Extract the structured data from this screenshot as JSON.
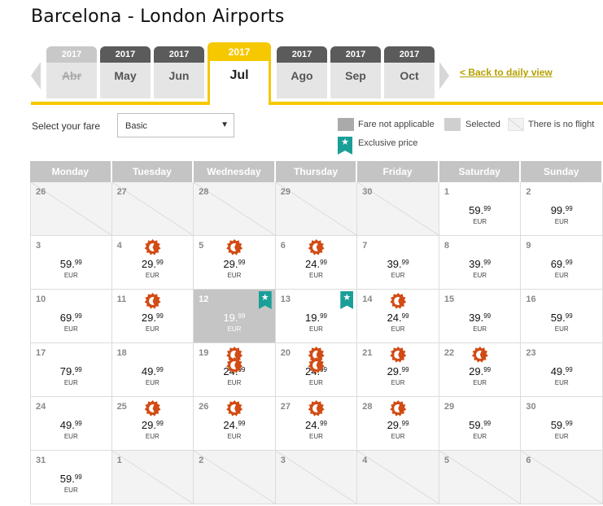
{
  "page": {
    "title": "Barcelona - London Airports"
  },
  "tabs": [
    {
      "year": "2017",
      "month": "Abr",
      "state": "disabled"
    },
    {
      "year": "2017",
      "month": "May",
      "state": "normal"
    },
    {
      "year": "2017",
      "month": "Jun",
      "state": "normal"
    },
    {
      "year": "2017",
      "month": "Jul",
      "state": "active"
    },
    {
      "year": "2017",
      "month": "Ago",
      "state": "normal"
    },
    {
      "year": "2017",
      "month": "Sep",
      "state": "normal"
    },
    {
      "year": "2017",
      "month": "Oct",
      "state": "normal"
    }
  ],
  "back_link": "< Back to daily view",
  "fare": {
    "label": "Select your fare",
    "selected": "Basic"
  },
  "legend": {
    "not_applicable": "Fare not applicable",
    "selected": "Selected",
    "no_flight": "There is no flight",
    "exclusive": "Exclusive price"
  },
  "weekdays": [
    "Monday",
    "Tuesday",
    "Wednesday",
    "Thursday",
    "Friday",
    "Saturday",
    "Sunday"
  ],
  "currency": "EUR",
  "cells": [
    {
      "day": "26",
      "noflight": true
    },
    {
      "day": "27",
      "noflight": true
    },
    {
      "day": "28",
      "noflight": true
    },
    {
      "day": "29",
      "noflight": true
    },
    {
      "day": "30",
      "noflight": true
    },
    {
      "day": "1",
      "int": "59.",
      "dec": "99",
      "badges": 0
    },
    {
      "day": "2",
      "int": "99.",
      "dec": "99",
      "badges": 0
    },
    {
      "day": "3",
      "int": "59.",
      "dec": "99",
      "badges": 0
    },
    {
      "day": "4",
      "int": "29.",
      "dec": "99",
      "badges": 1
    },
    {
      "day": "5",
      "int": "29.",
      "dec": "99",
      "badges": 1
    },
    {
      "day": "6",
      "int": "24.",
      "dec": "99",
      "badges": 1
    },
    {
      "day": "7",
      "int": "39.",
      "dec": "99",
      "badges": 0
    },
    {
      "day": "8",
      "int": "39.",
      "dec": "99",
      "badges": 0
    },
    {
      "day": "9",
      "int": "69.",
      "dec": "99",
      "badges": 0
    },
    {
      "day": "10",
      "int": "69.",
      "dec": "99",
      "badges": 0
    },
    {
      "day": "11",
      "int": "29.",
      "dec": "99",
      "badges": 1
    },
    {
      "day": "12",
      "int": "19.",
      "dec": "99",
      "badges": 0,
      "selected": true,
      "exclusive": true
    },
    {
      "day": "13",
      "int": "19.",
      "dec": "99",
      "badges": 0,
      "exclusive": true
    },
    {
      "day": "14",
      "int": "24.",
      "dec": "99",
      "badges": 1
    },
    {
      "day": "15",
      "int": "39.",
      "dec": "99",
      "badges": 0
    },
    {
      "day": "16",
      "int": "59.",
      "dec": "99",
      "badges": 0
    },
    {
      "day": "17",
      "int": "79.",
      "dec": "99",
      "badges": 0
    },
    {
      "day": "18",
      "int": "49.",
      "dec": "99",
      "badges": 0
    },
    {
      "day": "19",
      "int": "24.",
      "dec": "99",
      "badges": 2
    },
    {
      "day": "20",
      "int": "24.",
      "dec": "99",
      "badges": 2
    },
    {
      "day": "21",
      "int": "29.",
      "dec": "99",
      "badges": 1
    },
    {
      "day": "22",
      "int": "29.",
      "dec": "99",
      "badges": 1
    },
    {
      "day": "23",
      "int": "49.",
      "dec": "99",
      "badges": 0
    },
    {
      "day": "24",
      "int": "49.",
      "dec": "99",
      "badges": 0
    },
    {
      "day": "25",
      "int": "29.",
      "dec": "99",
      "badges": 1
    },
    {
      "day": "26",
      "int": "24.",
      "dec": "99",
      "badges": 1
    },
    {
      "day": "27",
      "int": "24.",
      "dec": "99",
      "badges": 1
    },
    {
      "day": "28",
      "int": "29.",
      "dec": "99",
      "badges": 1
    },
    {
      "day": "29",
      "int": "59.",
      "dec": "99",
      "badges": 0
    },
    {
      "day": "30",
      "int": "59.",
      "dec": "99",
      "badges": 0
    },
    {
      "day": "31",
      "int": "59.",
      "dec": "99",
      "badges": 0
    },
    {
      "day": "1",
      "noflight": true
    },
    {
      "day": "2",
      "noflight": true
    },
    {
      "day": "3",
      "noflight": true
    },
    {
      "day": "4",
      "noflight": true
    },
    {
      "day": "5",
      "noflight": true
    },
    {
      "day": "6",
      "noflight": true
    }
  ]
}
